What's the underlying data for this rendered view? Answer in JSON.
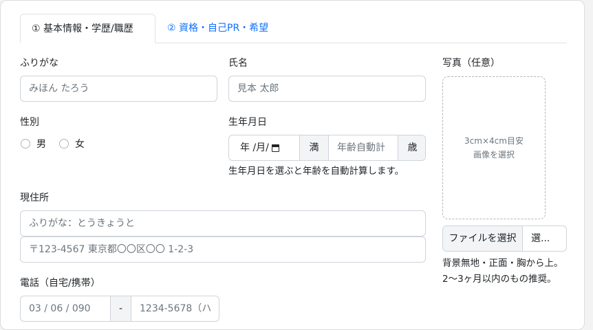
{
  "tabs": [
    {
      "label": "① 基本情報・学歴/職歴",
      "active": true
    },
    {
      "label": "② 資格・自己PR・希望",
      "active": false
    }
  ],
  "furigana": {
    "label": "ふりがな",
    "placeholder": "みほん たろう"
  },
  "name": {
    "label": "氏名",
    "placeholder": "見本 太郎"
  },
  "gender": {
    "label": "性別",
    "options": [
      "男",
      "女"
    ]
  },
  "birthdate": {
    "label": "生年月日",
    "date_placeholder": "年 /月/",
    "age_prefix": "満",
    "age_placeholder": "年齢自動計",
    "age_suffix": "歳",
    "help": "生年月日を選ぶと年齢を自動計算します。"
  },
  "address": {
    "label": "現住所",
    "furigana_placeholder": "ふりがな：とうきょうと",
    "address_placeholder": "〒123-4567 東京都〇〇区〇〇 1-2-3"
  },
  "phone": {
    "label": "電話（自宅/携帯）",
    "area_placeholder": "03 / 06 / 090",
    "separator": "-",
    "number_placeholder": "1234-5678（ハ"
  },
  "photo": {
    "label": "写真（任意）",
    "box_line1": "3cm×4cm目安",
    "box_line2": "画像を選択",
    "file_button": "ファイルを選択",
    "file_name": "選...",
    "help_line1": "背景無地・正面・胸から上。",
    "help_line2": "2〜3ヶ月以内のもの推奨。"
  },
  "colors": {
    "accent": "#0d6efd",
    "border": "#ced4da",
    "addon_bg": "#f2f4f6"
  }
}
